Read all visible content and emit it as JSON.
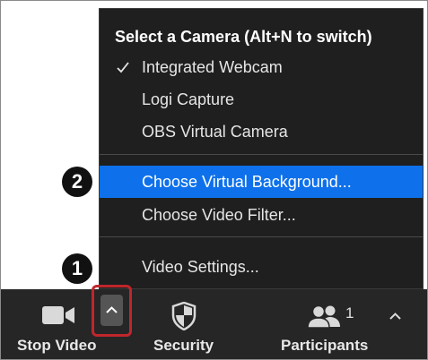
{
  "menu": {
    "header": "Select a Camera (Alt+N to switch)",
    "cameras": [
      {
        "label": "Integrated Webcam",
        "checked": true
      },
      {
        "label": "Logi Capture",
        "checked": false
      },
      {
        "label": "OBS Virtual Camera",
        "checked": false
      }
    ],
    "background_items": [
      {
        "label": "Choose Virtual Background...",
        "highlighted": true
      },
      {
        "label": "Choose Video Filter...",
        "highlighted": false
      }
    ],
    "settings_label": "Video Settings..."
  },
  "toolbar": {
    "stop_video_label": "Stop Video",
    "security_label": "Security",
    "participants_label": "Participants",
    "participant_count": "1"
  },
  "badges": {
    "step_one": "1",
    "step_two": "2"
  },
  "colors": {
    "highlight": "#0e71eb",
    "callout_border": "#c0262c",
    "toolbar_bg": "#262626",
    "menu_bg": "#1f1f1f"
  },
  "icons": [
    "video-camera-icon",
    "chevron-up-icon",
    "shield-icon",
    "participants-icon",
    "check-icon"
  ]
}
